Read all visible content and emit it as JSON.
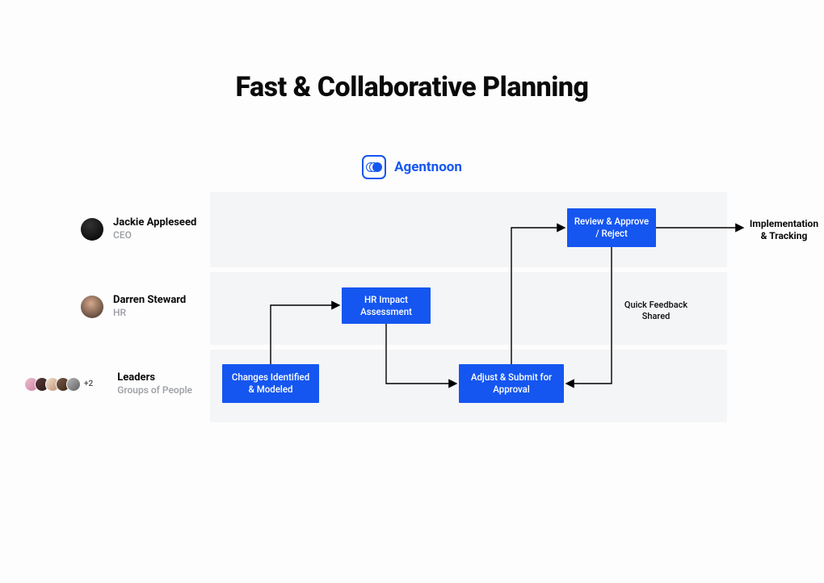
{
  "title": "Fast & Collaborative Planning",
  "brand": "Agentnoon",
  "roles": [
    {
      "name": "Jackie Appleseed",
      "sub": "CEO"
    },
    {
      "name": "Darren Steward",
      "sub": "HR"
    },
    {
      "name": "Leaders",
      "sub": "Groups of People"
    }
  ],
  "extra_count": "+2",
  "nodes": {
    "changes": "Changes Identified & Modeled",
    "hr_assess": "HR Impact Assessment",
    "review": "Review & Approve / Reject",
    "adjust": "Adjust & Submit for Approval"
  },
  "feedback_label": "Quick Feedback Shared",
  "output_label": "Implementation & Tracking",
  "chart_data": {
    "type": "swimlane-flow",
    "lanes": [
      {
        "role": "CEO",
        "person": "Jackie Appleseed",
        "nodes": [
          "Review & Approve / Reject"
        ]
      },
      {
        "role": "HR",
        "person": "Darren Steward",
        "nodes": [
          "HR Impact Assessment"
        ]
      },
      {
        "role": "Leaders",
        "person": "Groups of People",
        "nodes": [
          "Changes Identified & Modeled",
          "Adjust & Submit for Approval"
        ]
      }
    ],
    "edges": [
      {
        "from": "Changes Identified & Modeled",
        "to": "HR Impact Assessment"
      },
      {
        "from": "HR Impact Assessment",
        "to": "Adjust & Submit for Approval"
      },
      {
        "from": "Adjust & Submit for Approval",
        "to": "Review & Approve / Reject"
      },
      {
        "from": "Review & Approve / Reject",
        "to": "Adjust & Submit for Approval",
        "label": "Quick Feedback Shared"
      },
      {
        "from": "Review & Approve / Reject",
        "to": "Implementation & Tracking"
      }
    ]
  }
}
